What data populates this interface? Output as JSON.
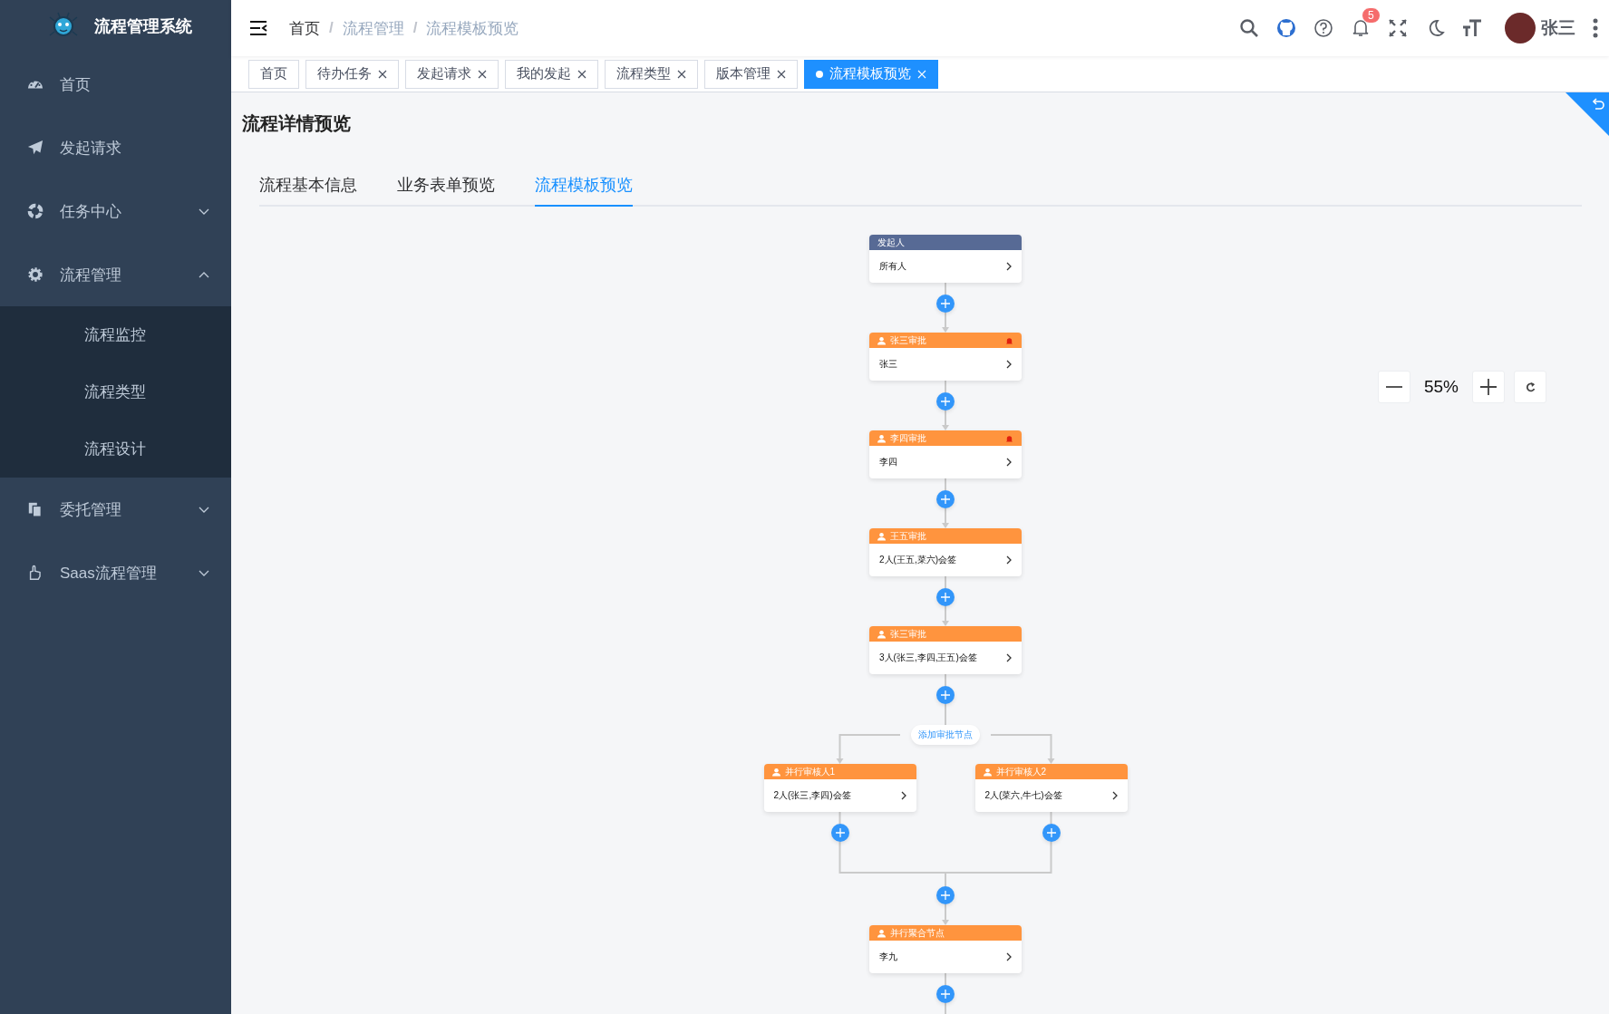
{
  "sidebar": {
    "title": "流程管理系统",
    "items": [
      {
        "label": "首页"
      },
      {
        "label": "发起请求"
      },
      {
        "label": "任务中心",
        "expanded": false
      },
      {
        "label": "流程管理",
        "expanded": true,
        "children": [
          {
            "label": "流程监控"
          },
          {
            "label": "流程类型"
          },
          {
            "label": "流程设计"
          }
        ]
      },
      {
        "label": "委托管理",
        "expanded": false
      },
      {
        "label": "Saas流程管理",
        "expanded": false
      }
    ]
  },
  "header": {
    "breadcrumbs": [
      "首页",
      "流程管理",
      "流程模板预览"
    ],
    "breadcrumb_separators": [
      "/",
      "/"
    ],
    "notification_count": "5",
    "user_name": "张三"
  },
  "tags": [
    {
      "label": "首页",
      "selected": false,
      "closable": false
    },
    {
      "label": "待办任务",
      "selected": false,
      "closable": true
    },
    {
      "label": "发起请求",
      "selected": false,
      "closable": true
    },
    {
      "label": "我的发起",
      "selected": false,
      "closable": true
    },
    {
      "label": "流程类型",
      "selected": false,
      "closable": true
    },
    {
      "label": "版本管理",
      "selected": false,
      "closable": true
    },
    {
      "label": "流程模板预览",
      "selected": true,
      "closable": true
    }
  ],
  "page": {
    "title": "流程详情预览",
    "tabs": [
      {
        "label": "流程基本信息",
        "selected": false
      },
      {
        "label": "业务表单预览",
        "selected": false
      },
      {
        "label": "流程模板预览",
        "selected": true
      }
    ]
  },
  "flow": {
    "nodes": [
      {
        "kind": "start",
        "title": "发起人",
        "content": "所有人",
        "alert": false
      },
      {
        "kind": "approver",
        "title": "张三审批",
        "content": "张三",
        "alert": true
      },
      {
        "kind": "approver",
        "title": "李四审批",
        "content": "李四",
        "alert": true
      },
      {
        "kind": "approver",
        "title": "王五审批",
        "content": "2人(王五,菜六)会签",
        "alert": false
      },
      {
        "kind": "approver",
        "title": "张三审批",
        "content": "3人(张三,李四,王五)会签",
        "alert": false
      },
      {
        "kind": "parallel",
        "button": "添加审批节点",
        "branches": [
          {
            "kind": "approver",
            "title": "并行审核人1",
            "content": "2人(张三,李四)会签",
            "alert": false
          },
          {
            "kind": "approver",
            "title": "并行审核人2",
            "content": "2人(菜六,牛七)会签",
            "alert": false
          }
        ]
      },
      {
        "kind": "approver",
        "title": "并行聚合节点",
        "content": "李九",
        "alert": false
      }
    ],
    "zoom": "55%"
  }
}
